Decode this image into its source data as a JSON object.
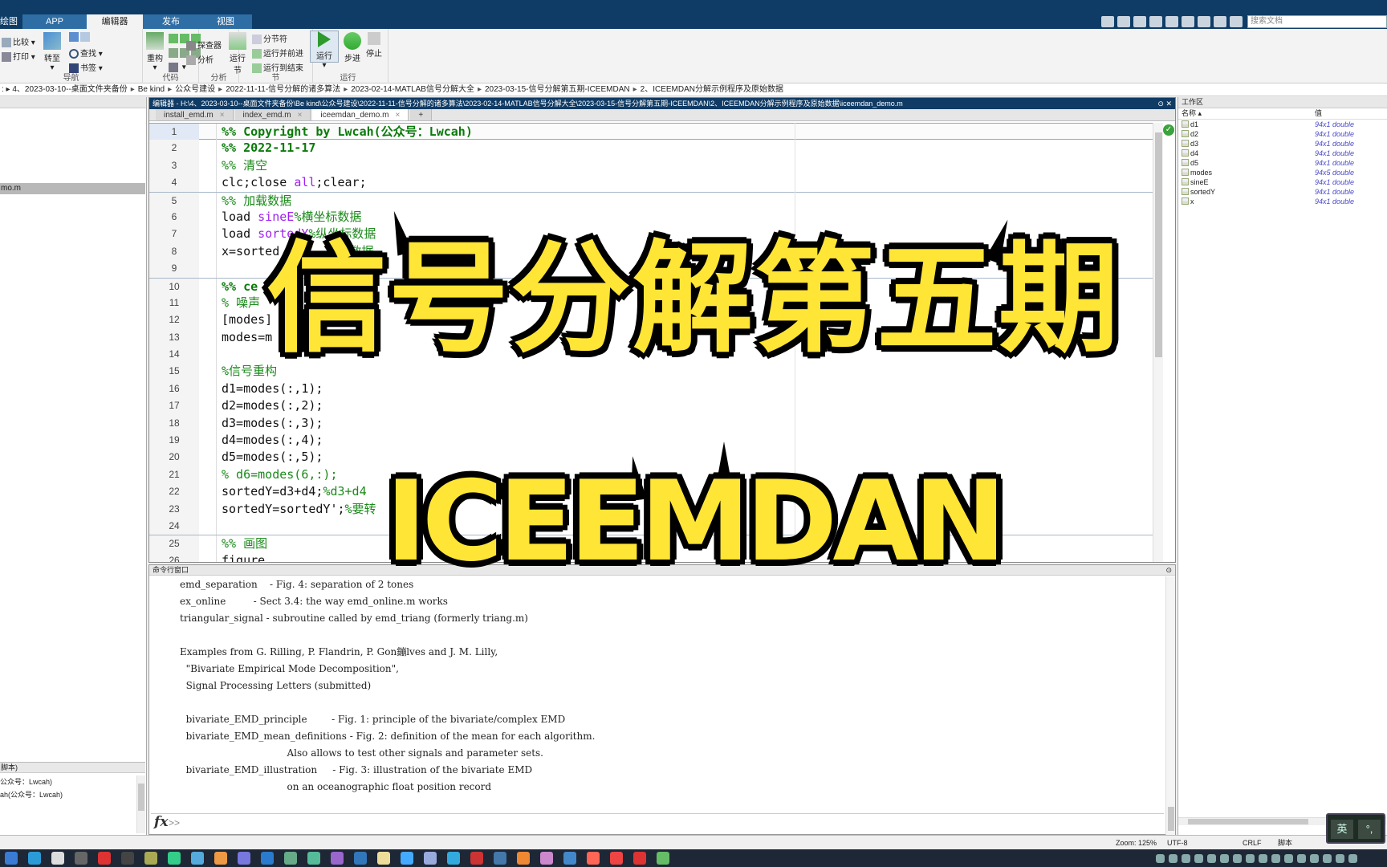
{
  "ribbon": {
    "tabs": [
      "绘图",
      "APP",
      "编辑器",
      "发布",
      "视图"
    ],
    "search_placeholder": "搜索文档",
    "nav": {
      "compare": "比较",
      "print": "打印",
      "goto": "转至",
      "find": "查找",
      "bookmark": "书签",
      "label": "导航"
    },
    "code": {
      "refactor": "重构",
      "label": "代码"
    },
    "analyze": {
      "profiler": "探查器",
      "analyze": "分析",
      "label": "分析"
    },
    "section": {
      "run_section": "运行节",
      "divider": "分节符",
      "run_advance": "运行并前进",
      "run_to_end": "运行到结束",
      "label": "节"
    },
    "run": {
      "run": "运行",
      "step": "步进",
      "stop": "停止",
      "label": "运行"
    }
  },
  "path": [
    "4、2023-03-10--桌面文件夹备份",
    "Be kind",
    "公众号建设",
    "2022-11-11-信号分解的诸多算法",
    "2023-02-14-MATLAB信号分解大全",
    "2023-03-15-信号分解第五期-ICEEMDAN",
    "2、ICEEMDAN分解示例程序及原始数据"
  ],
  "left": {
    "selected_file": "mo.m",
    "detail_header": "脚本)",
    "detail_lines": [
      "公众号：Lwcah)",
      "ah(公众号：Lwcah)"
    ]
  },
  "editor": {
    "title": "编辑器 - H:\\4、2023-03-10--桌面文件夹备份\\Be kind\\公众号建设\\2022-11-11-信号分解的诸多算法\\2023-02-14-MATLAB信号分解大全\\2023-03-15-信号分解第五期-ICEEMDAN\\2、ICEEMDAN分解示例程序及原始数据\\iceemdan_demo.m",
    "tabs": [
      "install_emd.m",
      "index_emd.m",
      "iceemdan_demo.m"
    ],
    "lines": [
      {
        "n": "1",
        "parts": [
          {
            "t": "%% Copyright by Lwcah(公众号：Lwcah)",
            "c": "c-cell"
          }
        ]
      },
      {
        "n": "2",
        "parts": [
          {
            "t": "%% 2022-11-17",
            "c": "c-cell"
          }
        ]
      },
      {
        "n": "3",
        "parts": [
          {
            "t": "%% 清空",
            "c": "c-com"
          }
        ]
      },
      {
        "n": "4",
        "parts": [
          {
            "t": "clc;close ",
            "c": ""
          },
          {
            "t": "all",
            "c": "c-str"
          },
          {
            "t": ";clear;",
            "c": ""
          }
        ]
      },
      {
        "n": "5",
        "parts": [
          {
            "t": "%% 加载数据",
            "c": "c-com"
          }
        ]
      },
      {
        "n": "6",
        "parts": [
          {
            "t": "load ",
            "c": ""
          },
          {
            "t": "sineE",
            "c": "c-str"
          },
          {
            "t": "%横坐标数据",
            "c": "c-com"
          }
        ]
      },
      {
        "n": "7",
        "parts": [
          {
            "t": "load ",
            "c": ""
          },
          {
            "t": "sortedY",
            "c": "c-str"
          },
          {
            "t": "%纵坐标数据",
            "c": "c-com"
          }
        ]
      },
      {
        "n": "8",
        "parts": [
          {
            "t": "x=sorted",
            "c": ""
          },
          {
            "t": "        的数据",
            "c": "c-com"
          }
        ]
      },
      {
        "n": "9",
        "parts": [
          {
            "t": "",
            "c": ""
          }
        ]
      },
      {
        "n": "10",
        "parts": [
          {
            "t": "%% ce",
            "c": "c-cell"
          }
        ]
      },
      {
        "n": "11",
        "parts": [
          {
            "t": "% 噪声",
            "c": "c-com"
          }
        ]
      },
      {
        "n": "12",
        "parts": [
          {
            "t": "[modes]            .2          ;",
            "c": ""
          }
        ]
      },
      {
        "n": "13",
        "parts": [
          {
            "t": "modes=m",
            "c": ""
          }
        ]
      },
      {
        "n": "14",
        "parts": [
          {
            "t": "",
            "c": ""
          }
        ]
      },
      {
        "n": "15",
        "parts": [
          {
            "t": "%信号重构",
            "c": "c-com"
          }
        ]
      },
      {
        "n": "16",
        "parts": [
          {
            "t": "d1=modes(:,1);",
            "c": ""
          }
        ]
      },
      {
        "n": "17",
        "parts": [
          {
            "t": "d2=modes(:,2);",
            "c": ""
          }
        ]
      },
      {
        "n": "18",
        "parts": [
          {
            "t": "d3=modes(:,3);",
            "c": ""
          }
        ]
      },
      {
        "n": "19",
        "parts": [
          {
            "t": "d4=modes(:,4);",
            "c": ""
          }
        ]
      },
      {
        "n": "20",
        "parts": [
          {
            "t": "d5=modes(:,5);",
            "c": ""
          }
        ]
      },
      {
        "n": "21",
        "parts": [
          {
            "t": "% d6=modes(6,:);",
            "c": "c-com"
          }
        ]
      },
      {
        "n": "22",
        "parts": [
          {
            "t": "sortedY=d3+d4;",
            "c": ""
          },
          {
            "t": "%d3+d4",
            "c": "c-com"
          }
        ]
      },
      {
        "n": "23",
        "parts": [
          {
            "t": "sortedY=sortedY';",
            "c": ""
          },
          {
            "t": "%要转",
            "c": "c-com"
          }
        ]
      },
      {
        "n": "24",
        "parts": [
          {
            "t": "",
            "c": ""
          }
        ]
      },
      {
        "n": "25",
        "parts": [
          {
            "t": "%% 画图",
            "c": "c-com"
          }
        ]
      },
      {
        "n": "26",
        "parts": [
          {
            "t": "figure",
            "c": ""
          }
        ]
      }
    ]
  },
  "command": {
    "header": "命令行窗口",
    "lines": [
      "emd_separation    - Fig. 4: separation of 2 tones",
      "ex_online         - Sect 3.4: the way emd_online.m works",
      "triangular_signal - subroutine called by emd_triang (formerly triang.m)",
      "",
      "Examples from G. Rilling, P. Flandrin, P. Gon鏰lves and J. M. Lilly,",
      "  \"Bivariate Empirical Mode Decomposition\",",
      "  Signal Processing Letters (submitted)",
      "",
      "  bivariate_EMD_principle        - Fig. 1: principle of the bivariate/complex EMD",
      "  bivariate_EMD_mean_definitions - Fig. 2: definition of the mean for each algorithm.",
      "                                   Also allows to test other signals and parameter sets.",
      "  bivariate_EMD_illustration     - Fig. 3: illustration of the bivariate EMD",
      "                                   on an oceanographic float position record"
    ],
    "prompt": ">>"
  },
  "workspace": {
    "header": "工作区",
    "col_name": "名称 ▴",
    "col_value": "值",
    "vars": [
      {
        "name": "d1",
        "value": "94x1 double"
      },
      {
        "name": "d2",
        "value": "94x1 double"
      },
      {
        "name": "d3",
        "value": "94x1 double"
      },
      {
        "name": "d4",
        "value": "94x1 double"
      },
      {
        "name": "d5",
        "value": "94x1 double"
      },
      {
        "name": "modes",
        "value": "94x5 double"
      },
      {
        "name": "sineE",
        "value": "94x1 double"
      },
      {
        "name": "sortedY",
        "value": "94x1 double"
      },
      {
        "name": "x",
        "value": "94x1 double"
      }
    ]
  },
  "status": {
    "zoom": "Zoom: 125%",
    "encoding": "UTF-8",
    "eol": "CRLF",
    "type": "脚本"
  },
  "ime": {
    "lang": "英",
    "punct": "°,"
  },
  "overlay": {
    "line1": "信号分解第五期",
    "line2": "ICEEMDAN"
  },
  "colors": {
    "titlebar": "#0e3c66",
    "overlay_text": "#ffe535",
    "cell_comment": "#0a7a0a",
    "keyword_string": "#a020f0"
  }
}
